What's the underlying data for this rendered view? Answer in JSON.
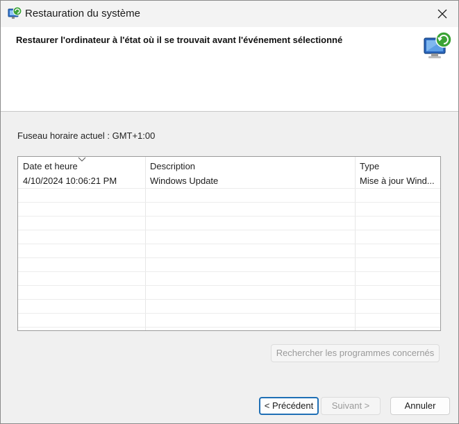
{
  "window": {
    "title": "Restauration du système"
  },
  "header": {
    "text": "Restaurer l'ordinateur à l'état où il se trouvait avant l'événement sélectionné"
  },
  "timezone": {
    "label": "Fuseau horaire actuel : GMT+1:00"
  },
  "table": {
    "columns": [
      "Date et heure",
      "Description",
      "Type"
    ],
    "sorted_column": "Date et heure",
    "rows": [
      {
        "date": "4/10/2024 10:06:21 PM",
        "description": "Windows Update",
        "type": "Mise à jour Wind..."
      }
    ]
  },
  "buttons": {
    "scan": "Rechercher les programmes concernés",
    "previous": "< Précédent",
    "next": "Suivant >",
    "cancel": "Annuler"
  },
  "icons": {
    "app": "system-restore-icon",
    "header": "system-restore-monitor-icon",
    "close": "close-icon",
    "sort": "sort-descending-icon"
  },
  "colors": {
    "accent": "#1f6fb5",
    "header_bg": "#ffffff",
    "body_bg": "#f0f0f0"
  }
}
